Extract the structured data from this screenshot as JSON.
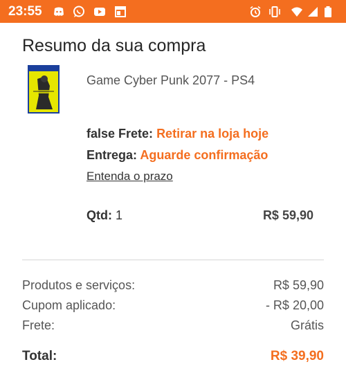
{
  "status_bar": {
    "time": "23:55",
    "background": "#f46e1f",
    "left_icons": [
      "discord-icon",
      "whatsapp-icon",
      "youtube-icon",
      "browser-window-icon"
    ],
    "right_icons": [
      "alarm-icon",
      "vibrate-icon",
      "wifi-icon",
      "signal-icon",
      "battery-icon"
    ]
  },
  "page": {
    "title": "Resumo da sua compra"
  },
  "product": {
    "name": "Game Cyber Punk 2077 - PS4",
    "thumb_icon": "game-cover-image",
    "shipping_label": "false Frete:",
    "shipping_value": "Retirar na loja hoje",
    "delivery_label": "Entrega:",
    "delivery_value": "Aguarde confirmação",
    "deadline_link": "Entenda o prazo",
    "qty_label": "Qtd:",
    "qty_value": "1",
    "price": "R$ 59,90"
  },
  "summary": {
    "products_label": "Produtos e serviços:",
    "products_value": "R$ 59,90",
    "coupon_label": "Cupom aplicado:",
    "coupon_value": "- R$ 20,00",
    "shipping_label": "Frete:",
    "shipping_value": "Grátis",
    "total_label": "Total:",
    "total_value": "R$ 39,90"
  },
  "colors": {
    "accent": "#f46e1f",
    "text": "#333333",
    "divider": "#d6d6d6"
  }
}
